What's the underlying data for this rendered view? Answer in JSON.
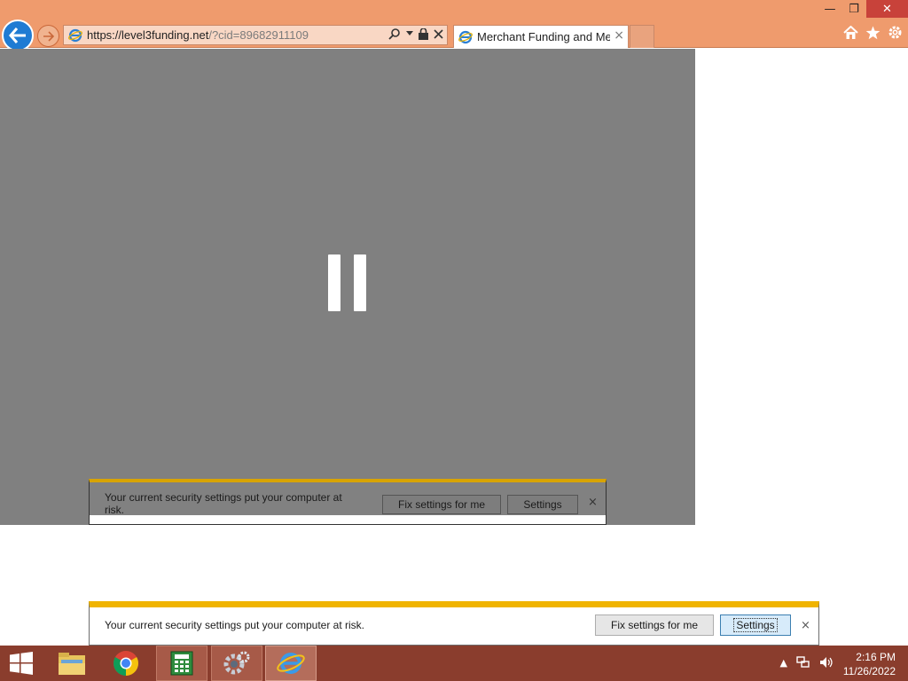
{
  "browser": {
    "url_main": "https://level3funding.net",
    "url_query": "/?cid=89682911109",
    "tab_title": "Merchant Funding and Mer...",
    "tab_close": "×",
    "window_controls": {
      "minimize": "—",
      "maximize": "❐",
      "close": "✕"
    }
  },
  "infobar_ghost": {
    "message": "Your current security settings put your computer at risk.",
    "fix_label": "Fix settings for me",
    "settings_label": "Settings",
    "close": "×"
  },
  "infobar": {
    "message": "Your current security settings put your computer at risk.",
    "fix_label": "Fix settings for me",
    "settings_label": "Settings",
    "close": "×"
  },
  "taskbar": {
    "time": "2:16 PM",
    "date": "11/26/2022"
  },
  "icons": [
    "back-arrow-icon",
    "forward-arrow-icon",
    "ie-icon",
    "search-icon",
    "lock-icon",
    "close-icon",
    "home-icon",
    "star-icon",
    "gear-icon",
    "pause-icon",
    "windows-icon",
    "folder-icon",
    "chrome-icon",
    "calculator-icon",
    "settings-gear-icon",
    "speaker-icon",
    "network-icon"
  ],
  "colors": {
    "chrome_bar": "#ef9b6d",
    "taskbar": "#8a3d2d",
    "warning": "#f0b400",
    "accent": "#1f7bd3"
  }
}
